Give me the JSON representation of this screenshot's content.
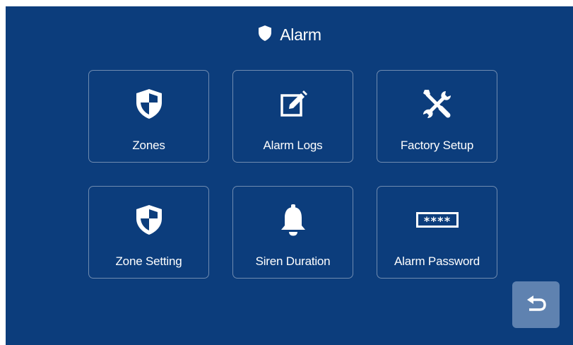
{
  "header": {
    "title": "Alarm",
    "icon": "shield-icon"
  },
  "tiles": [
    {
      "label": "Zones",
      "icon": "shield-checker-icon"
    },
    {
      "label": "Alarm Logs",
      "icon": "edit-log-icon"
    },
    {
      "label": "Factory Setup",
      "icon": "tools-icon"
    },
    {
      "label": "Zone Setting",
      "icon": "shield-checker-icon"
    },
    {
      "label": "Siren Duration",
      "icon": "bell-icon"
    },
    {
      "label": "Alarm Password",
      "icon": "password-icon",
      "password_mask": "****"
    }
  ],
  "back": {
    "icon": "back-arrow-icon"
  },
  "colors": {
    "background": "#0c3d7c",
    "tile_border": "#6f8bb0",
    "back_button": "#5f82b0",
    "text": "#ffffff"
  }
}
